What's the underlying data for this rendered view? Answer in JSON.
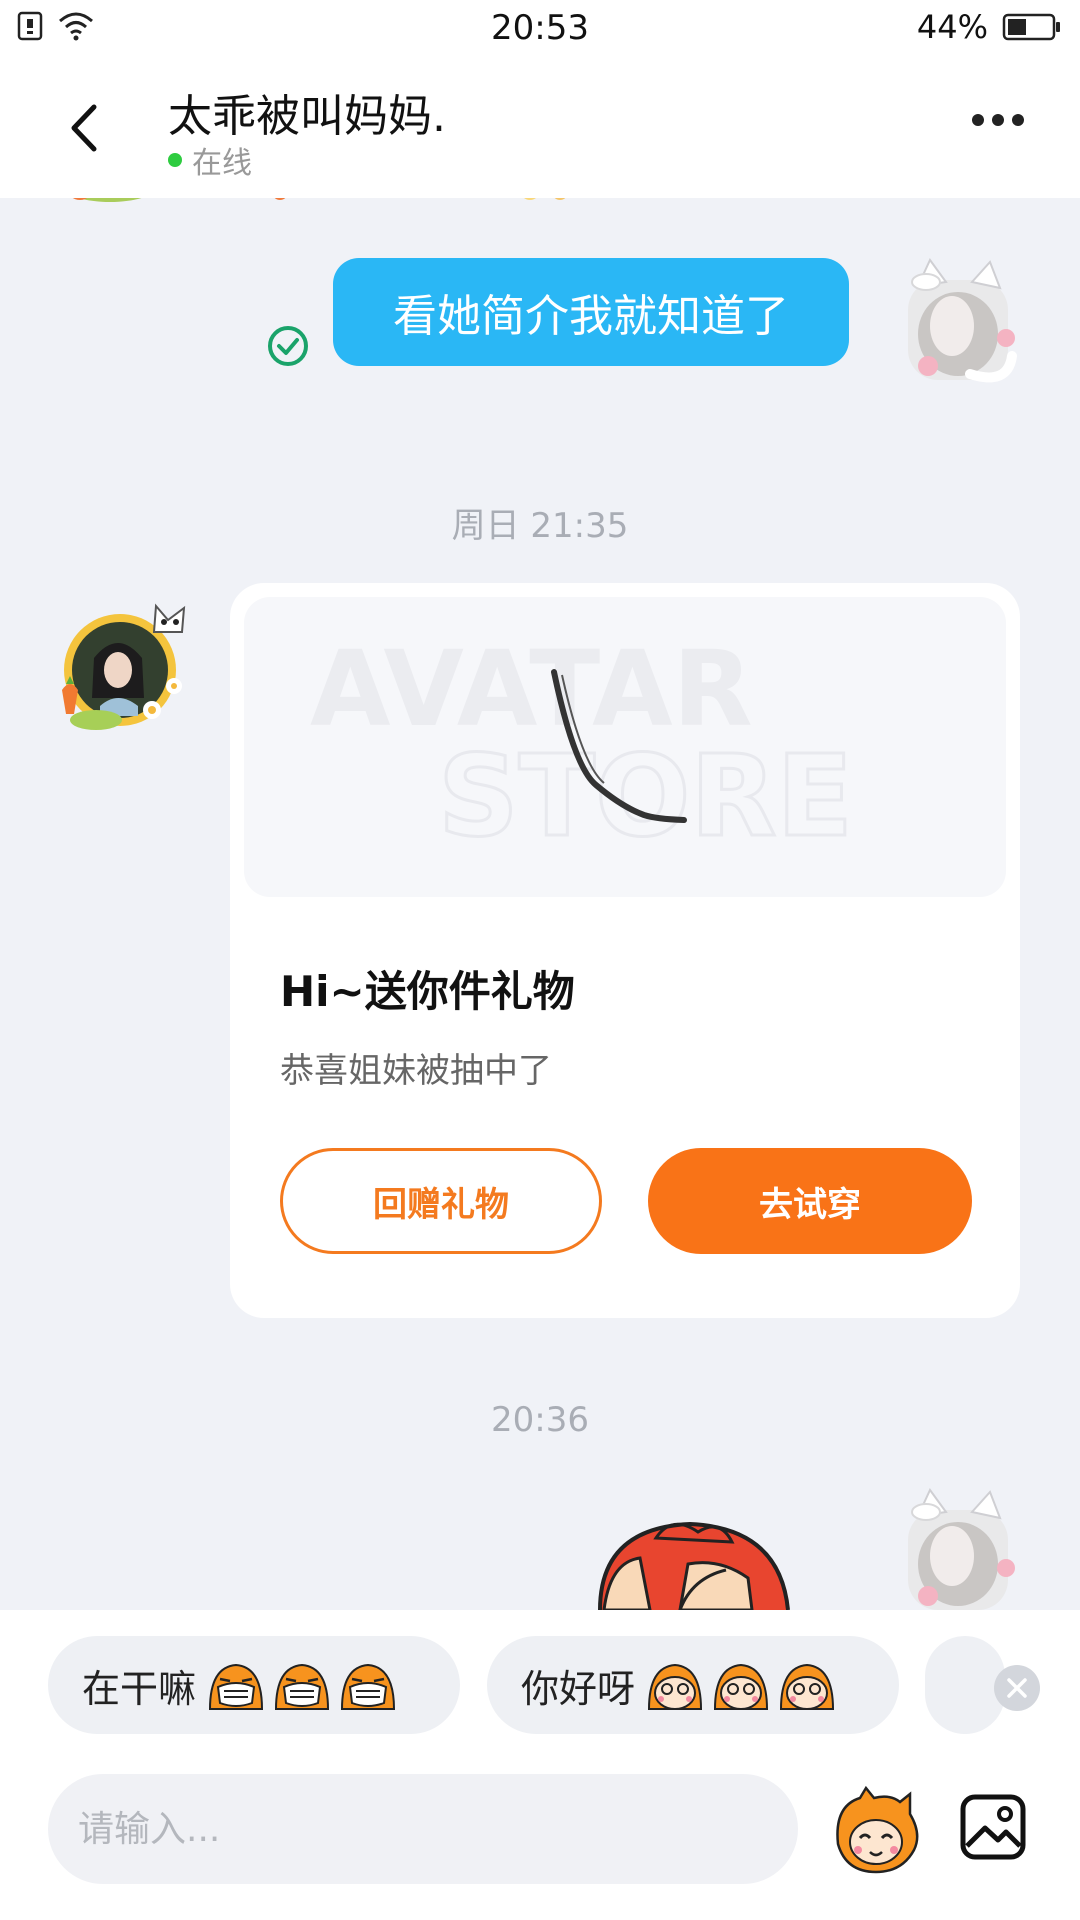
{
  "status_bar": {
    "time": "20:53",
    "battery_text": "44%",
    "battery_level": 0.44
  },
  "header": {
    "title": "太乖被叫妈妈.",
    "status_text": "在线",
    "status_color": "#2ecc40"
  },
  "messages": {
    "sent_text": "看她简介我就知道了",
    "timestamp_1": "周日 21:35",
    "timestamp_2": "20:36"
  },
  "gift_card": {
    "watermark_line1": "AVATAR",
    "watermark_line2": "STORE",
    "title": "Hi~送你件礼物",
    "subtitle": "恭喜姐妹被抽中了",
    "return_button": "回赠礼物",
    "try_button": "去试穿"
  },
  "quick_replies": [
    {
      "label": "在干嘛"
    },
    {
      "label": "你好呀"
    }
  ],
  "input": {
    "placeholder": "请输入..."
  },
  "colors": {
    "sent_bubble": "#2ab7f5",
    "accent_orange": "#f97317",
    "background": "#f0f2f7"
  },
  "icons": [
    "back-icon",
    "more-icon",
    "read-check-icon",
    "close-icon",
    "emoji-icon",
    "image-icon",
    "wifi-icon",
    "sim-icon",
    "battery-icon"
  ]
}
